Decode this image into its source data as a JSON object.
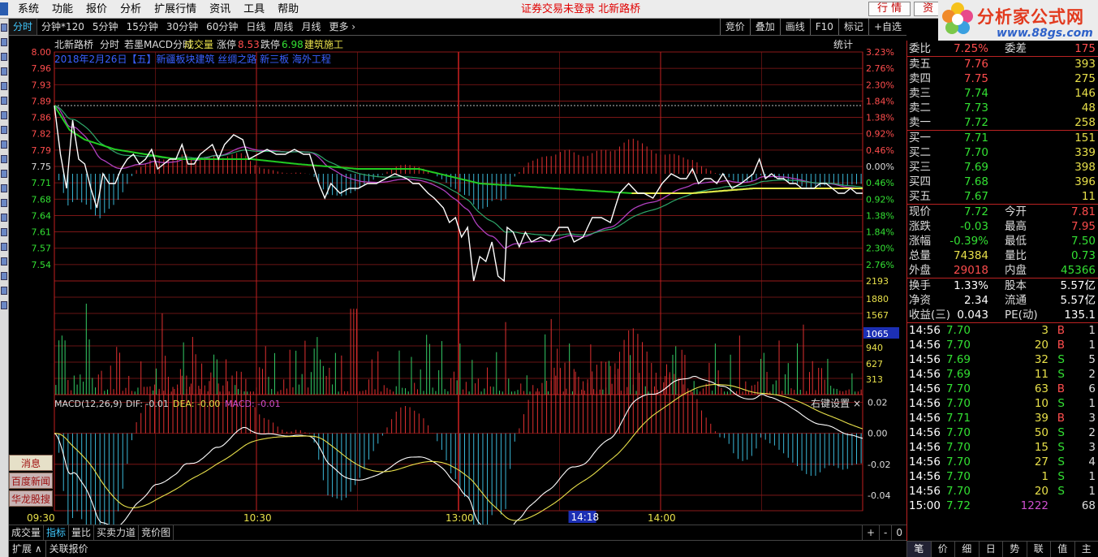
{
  "menubar": {
    "items": [
      "系统",
      "功能",
      "报价",
      "分析",
      "扩展行情",
      "资讯",
      "工具",
      "帮助"
    ],
    "status": "证券交易未登录  北新路桥",
    "buttons": [
      "行 情",
      "资"
    ]
  },
  "logo": {
    "title": "分析家公式网",
    "url": "www.88gs.com"
  },
  "tabs": {
    "items": [
      "分时",
      "分钟*120",
      "5分钟",
      "15分钟",
      "30分钟",
      "60分钟",
      "日线",
      "周线",
      "月线",
      "更多 ›"
    ],
    "right": [
      "竞价",
      "叠加",
      "画线",
      "F10",
      "标记",
      "+自选"
    ]
  },
  "chart_data": {
    "type": "line",
    "header": {
      "name": "北新路桥",
      "period": "分时",
      "indicator": "若墨MACD分时",
      "volume_label": "成交量",
      "limit_up_label": "涨停",
      "limit_up": "8.53",
      "limit_down_label": "跌停",
      "limit_down": "6.98",
      "sector": "建筑施工",
      "stat": "统计"
    },
    "date_line": "2018年2月26日【五】新疆板块建筑    丝绸之路 新三板 海外工程",
    "price_ticks": [
      "8.00",
      "7.96",
      "7.93",
      "7.89",
      "7.86",
      "7.82",
      "7.79",
      "7.75",
      "7.71",
      "7.68",
      "7.64",
      "7.61",
      "7.57",
      "7.54"
    ],
    "pct_ticks": [
      "3.23%",
      "2.76%",
      "2.30%",
      "1.84%",
      "1.38%",
      "0.92%",
      "0.46%",
      "0.00%",
      "0.46%",
      "0.92%",
      "1.38%",
      "1.84%",
      "2.30%",
      "2.76%"
    ],
    "ylim": [
      7.53,
      8.0
    ],
    "ref_close": 7.75,
    "vol_ticks": [
      "2193",
      "1880",
      "1567",
      "1065",
      "940",
      "627",
      "313"
    ],
    "vol_cursor": "1065",
    "vol_max": 2193,
    "macd_label": "MACD(12,26,9)",
    "dif_label": "DIF: -0.01",
    "dea_label": "DEA: -0.00",
    "macd_value_label": "MACD: -0.01",
    "macd_right": "右键设置 ×",
    "macd_ticks": [
      "0.02",
      "0.00",
      "-0.02",
      "-0.04"
    ],
    "macd_ylim": [
      -0.05,
      0.025
    ],
    "time_labels": [
      "09:30",
      "10:30",
      "13:00",
      "14:00"
    ],
    "cursor_time": "14:18",
    "price_keys": [
      [
        0,
        7.89
      ],
      [
        4,
        7.79
      ],
      [
        8,
        7.72
      ],
      [
        12,
        7.86
      ],
      [
        16,
        7.78
      ],
      [
        20,
        7.77
      ],
      [
        24,
        7.72
      ],
      [
        28,
        7.68
      ],
      [
        32,
        7.75
      ],
      [
        36,
        7.73
      ],
      [
        40,
        7.73
      ],
      [
        44,
        7.76
      ],
      [
        48,
        7.78
      ],
      [
        52,
        7.79
      ],
      [
        56,
        7.77
      ],
      [
        60,
        7.78
      ],
      [
        64,
        7.8
      ],
      [
        68,
        7.76
      ],
      [
        72,
        7.77
      ],
      [
        76,
        7.78
      ],
      [
        80,
        7.78
      ],
      [
        84,
        7.81
      ],
      [
        88,
        7.77
      ],
      [
        92,
        7.77
      ],
      [
        96,
        7.79
      ],
      [
        100,
        7.8
      ],
      [
        104,
        7.81
      ],
      [
        108,
        7.78
      ],
      [
        112,
        7.81
      ],
      [
        118,
        7.83
      ],
      [
        124,
        7.82
      ],
      [
        128,
        7.78
      ],
      [
        134,
        7.79
      ],
      [
        140,
        7.8
      ],
      [
        146,
        7.79
      ],
      [
        152,
        7.79
      ],
      [
        158,
        7.8
      ],
      [
        164,
        7.79
      ],
      [
        168,
        7.79
      ],
      [
        174,
        7.73
      ],
      [
        178,
        7.7
      ],
      [
        182,
        7.73
      ],
      [
        188,
        7.71
      ],
      [
        194,
        7.72
      ],
      [
        200,
        7.72
      ],
      [
        206,
        7.73
      ],
      [
        212,
        7.73
      ],
      [
        218,
        7.74
      ],
      [
        224,
        7.75
      ],
      [
        232,
        7.74
      ],
      [
        236,
        7.73
      ],
      [
        240,
        7.73
      ],
      [
        246,
        7.71
      ],
      [
        250,
        7.7
      ],
      [
        256,
        7.68
      ],
      [
        260,
        7.65
      ],
      [
        264,
        7.66
      ],
      [
        268,
        7.62
      ],
      [
        272,
        7.64
      ],
      [
        276,
        7.53
      ],
      [
        280,
        7.58
      ],
      [
        284,
        7.57
      ],
      [
        288,
        7.61
      ],
      [
        292,
        7.54
      ],
      [
        296,
        7.53
      ],
      [
        298,
        7.64
      ],
      [
        302,
        7.63
      ],
      [
        306,
        7.6
      ],
      [
        310,
        7.63
      ],
      [
        314,
        7.61
      ],
      [
        320,
        7.62
      ],
      [
        326,
        7.61
      ],
      [
        332,
        7.64
      ],
      [
        338,
        7.64
      ],
      [
        342,
        7.61
      ],
      [
        348,
        7.62
      ],
      [
        354,
        7.66
      ],
      [
        360,
        7.66
      ],
      [
        366,
        7.65
      ],
      [
        372,
        7.71
      ],
      [
        378,
        7.73
      ],
      [
        384,
        7.71
      ],
      [
        388,
        7.71
      ],
      [
        394,
        7.7
      ],
      [
        400,
        7.73
      ],
      [
        406,
        7.75
      ],
      [
        412,
        7.74
      ],
      [
        416,
        7.74
      ],
      [
        420,
        7.76
      ],
      [
        424,
        7.73
      ],
      [
        428,
        7.74
      ],
      [
        432,
        7.74
      ],
      [
        436,
        7.73
      ],
      [
        440,
        7.75
      ],
      [
        446,
        7.72
      ],
      [
        452,
        7.73
      ],
      [
        456,
        7.74
      ],
      [
        460,
        7.75
      ],
      [
        464,
        7.78
      ],
      [
        468,
        7.74
      ],
      [
        472,
        7.75
      ],
      [
        476,
        7.74
      ],
      [
        480,
        7.74
      ],
      [
        484,
        7.73
      ],
      [
        488,
        7.73
      ],
      [
        492,
        7.72
      ],
      [
        496,
        7.72
      ],
      [
        500,
        7.72
      ],
      [
        504,
        7.73
      ],
      [
        508,
        7.73
      ],
      [
        512,
        7.72
      ],
      [
        516,
        7.71
      ],
      [
        520,
        7.71
      ],
      [
        524,
        7.72
      ],
      [
        528,
        7.71
      ],
      [
        532,
        7.71
      ]
    ],
    "avg_keys": [
      [
        0,
        7.89
      ],
      [
        10,
        7.84
      ],
      [
        20,
        7.82
      ],
      [
        40,
        7.8
      ],
      [
        60,
        7.79
      ],
      [
        80,
        7.78
      ],
      [
        100,
        7.78
      ],
      [
        130,
        7.78
      ],
      [
        160,
        7.77
      ],
      [
        200,
        7.76
      ],
      [
        240,
        7.76
      ],
      [
        280,
        7.73
      ],
      [
        330,
        7.72
      ],
      [
        380,
        7.71
      ],
      [
        420,
        7.71
      ],
      [
        460,
        7.72
      ],
      [
        500,
        7.72
      ],
      [
        532,
        7.72
      ]
    ]
  },
  "right": {
    "weibi": {
      "label": "委比",
      "value": "7.25%",
      "label2": "委差",
      "value2": "175"
    },
    "asks": [
      {
        "label": "卖五",
        "price": "7.76",
        "vol": "393"
      },
      {
        "label": "卖四",
        "price": "7.75",
        "vol": "275"
      },
      {
        "label": "卖三",
        "price": "7.74",
        "vol": "146"
      },
      {
        "label": "卖二",
        "price": "7.73",
        "vol": "48"
      },
      {
        "label": "卖一",
        "price": "7.72",
        "vol": "258"
      }
    ],
    "bids": [
      {
        "label": "买一",
        "price": "7.71",
        "vol": "151"
      },
      {
        "label": "买二",
        "price": "7.70",
        "vol": "339"
      },
      {
        "label": "买三",
        "price": "7.69",
        "vol": "398"
      },
      {
        "label": "买四",
        "price": "7.68",
        "vol": "396"
      },
      {
        "label": "买五",
        "price": "7.67",
        "vol": "11"
      }
    ],
    "stats": [
      {
        "l1": "现价",
        "v1": "7.72",
        "c1": "#33e033",
        "l2": "今开",
        "v2": "7.81",
        "c2": "#ff4d4d"
      },
      {
        "l1": "涨跌",
        "v1": "-0.03",
        "c1": "#33e033",
        "l2": "最高",
        "v2": "7.95",
        "c2": "#ff4d4d"
      },
      {
        "l1": "涨幅",
        "v1": "-0.39%",
        "c1": "#33e033",
        "l2": "最低",
        "v2": "7.50",
        "c2": "#33e033"
      },
      {
        "l1": "总量",
        "v1": "74384",
        "c1": "#e8e04a",
        "l2": "量比",
        "v2": "0.73",
        "c2": "#33e033"
      },
      {
        "l1": "外盘",
        "v1": "29018",
        "c1": "#ff4d4d",
        "l2": "内盘",
        "v2": "45366",
        "c2": "#33e033"
      }
    ],
    "stats2": [
      {
        "l1": "换手",
        "v1": "1.33%",
        "l2": "股本",
        "v2": "5.57亿"
      },
      {
        "l1": "净资",
        "v1": "2.34",
        "l2": "流通",
        "v2": "5.57亿"
      },
      {
        "l1": "收益(三)",
        "v1": "0.043",
        "l2": "PE(动)",
        "v2": "135.1"
      }
    ],
    "trades": [
      {
        "t": "14:56",
        "p": "7.70",
        "v": "3",
        "s": "B",
        "n": "1"
      },
      {
        "t": "14:56",
        "p": "7.70",
        "v": "20",
        "s": "B",
        "n": "1"
      },
      {
        "t": "14:56",
        "p": "7.69",
        "v": "32",
        "s": "S",
        "n": "5"
      },
      {
        "t": "14:56",
        "p": "7.69",
        "v": "11",
        "s": "S",
        "n": "2"
      },
      {
        "t": "14:56",
        "p": "7.70",
        "v": "63",
        "s": "B",
        "n": "6"
      },
      {
        "t": "14:56",
        "p": "7.70",
        "v": "10",
        "s": "S",
        "n": "1"
      },
      {
        "t": "14:56",
        "p": "7.71",
        "v": "39",
        "s": "B",
        "n": "3"
      },
      {
        "t": "14:56",
        "p": "7.70",
        "v": "50",
        "s": "S",
        "n": "2"
      },
      {
        "t": "14:56",
        "p": "7.70",
        "v": "15",
        "s": "S",
        "n": "3"
      },
      {
        "t": "14:56",
        "p": "7.70",
        "v": "27",
        "s": "S",
        "n": "4"
      },
      {
        "t": "14:56",
        "p": "7.70",
        "v": "1",
        "s": "S",
        "n": "1"
      },
      {
        "t": "14:56",
        "p": "7.70",
        "v": "20",
        "s": "S",
        "n": "1"
      },
      {
        "t": "15:00",
        "p": "7.72",
        "v": "1222",
        "s": "",
        "n": "68"
      }
    ]
  },
  "bottom": {
    "tabs": [
      "成交量",
      "指标",
      "量比",
      "买卖力道",
      "竞价图"
    ],
    "ctrl": [
      "+",
      "-",
      "0"
    ]
  },
  "ext": {
    "items": [
      "扩展 ∧",
      "关联报价"
    ]
  },
  "side": {
    "items": [
      "消息",
      "百度新闻",
      "华龙股搜"
    ]
  },
  "righttabs": {
    "items": [
      "笔",
      "价",
      "细",
      "日",
      "势",
      "联",
      "值",
      "主"
    ]
  },
  "colors": {
    "up": "#ff4d4d",
    "down": "#33e033",
    "grid": "#8c1a1a",
    "price_line": "#ffffff",
    "avg_line": "#e8e84a",
    "ma_green": "#22cc22"
  }
}
